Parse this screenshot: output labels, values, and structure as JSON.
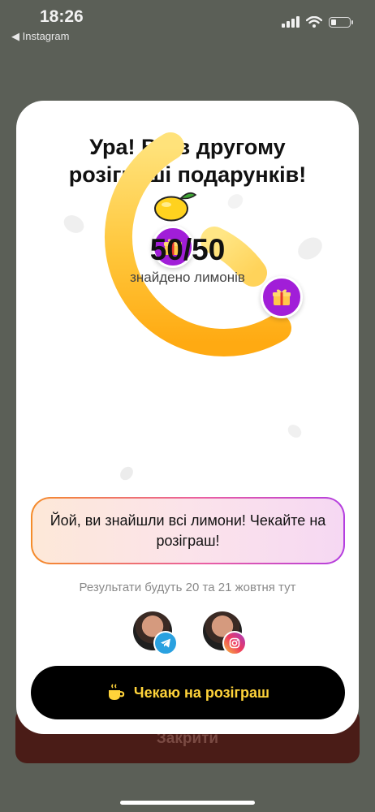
{
  "status_bar": {
    "time": "18:26",
    "back_app": "◀ Instagram"
  },
  "behind": {
    "close_label": "Закрити"
  },
  "card": {
    "title_line1": "Ура! Ви в другому",
    "title_line2": "розіграші подарунків!",
    "progress": {
      "found": 50,
      "total": 50,
      "display": "50/50",
      "label": "знайдено лимонів"
    },
    "message": "Йой, ви знайшли всі лимони! Чекайте на розіграш!",
    "results_note": "Результати будуть 20 та 21 жовтня тут",
    "socials": [
      {
        "icon": "telegram-icon"
      },
      {
        "icon": "instagram-icon"
      }
    ],
    "wait_button": "Чекаю на розіграш"
  },
  "colors": {
    "ring": "#ffb81e",
    "gift_badge": "#a11ed8",
    "button_text": "#ffd33a",
    "background": "#5b5f57"
  }
}
